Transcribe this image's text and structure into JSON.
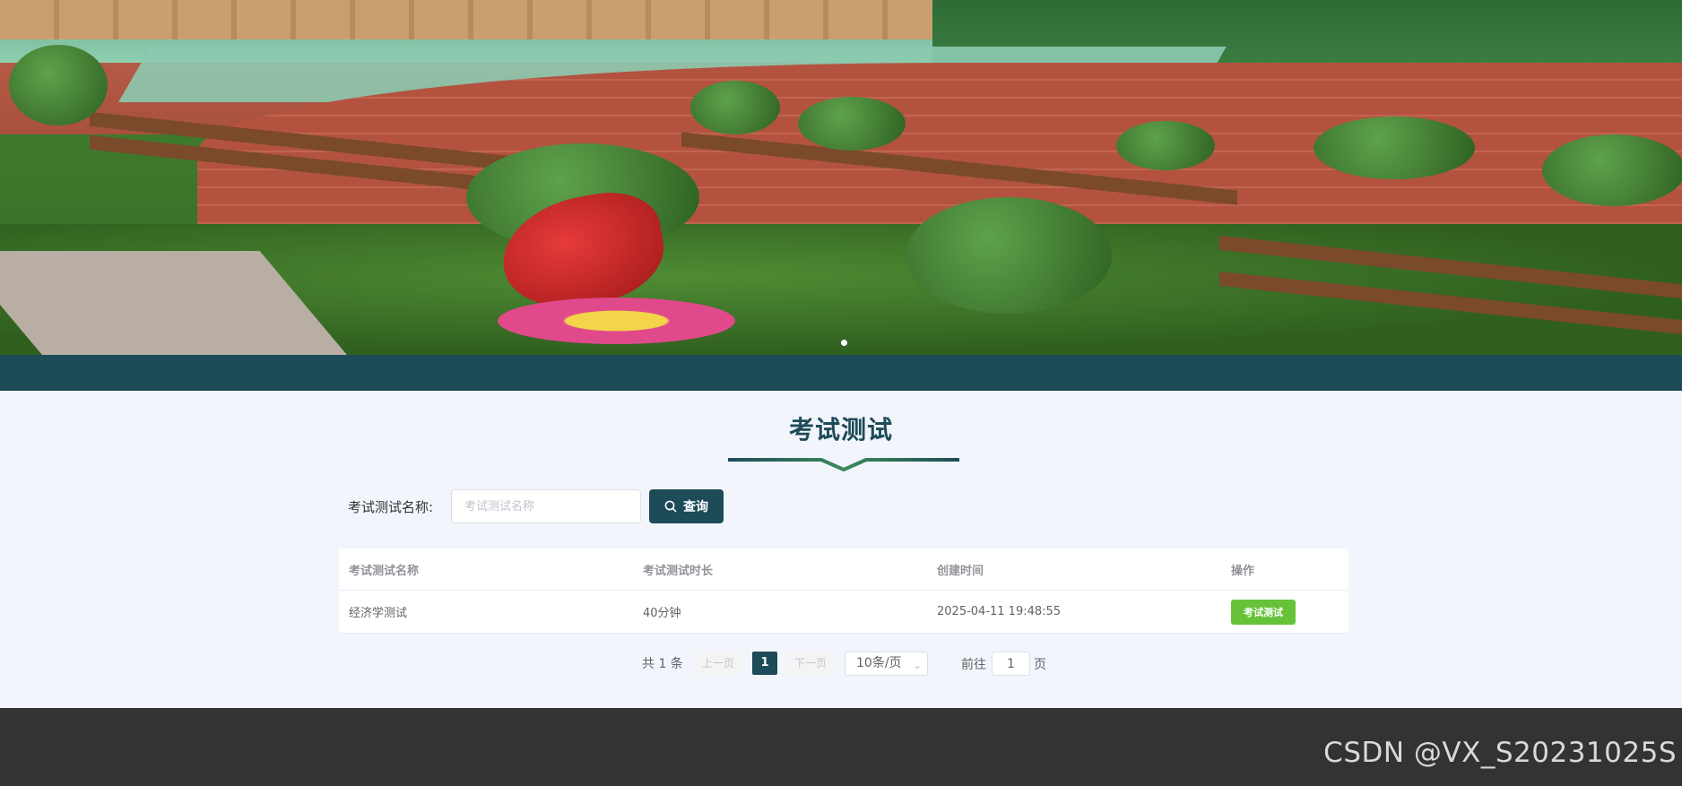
{
  "banner": {
    "indicator_count": 1,
    "active_indicator": 0
  },
  "page": {
    "title": "考试测试"
  },
  "search": {
    "label": "考试测试名称:",
    "placeholder": "考试测试名称",
    "value": "",
    "button_label": "查询",
    "button_icon": "search-icon"
  },
  "table": {
    "columns": [
      "考试测试名称",
      "考试测试时长",
      "创建时间",
      "操作"
    ],
    "rows": [
      {
        "name": "经济学测试",
        "duration": "40分钟",
        "created": "2025-04-11 19:48:55",
        "action": "考试测试"
      }
    ]
  },
  "pagination": {
    "total_text": "共 1 条",
    "prev_label": "上一页",
    "next_label": "下一页",
    "current_page": "1",
    "page_size": "10条/页",
    "goto_label": "前往",
    "goto_value": "1",
    "page_suffix": "页"
  },
  "footer": {
    "watermark": "CSDN @VX_S20231025S"
  },
  "colors": {
    "primary": "#1d4b58",
    "success": "#67c23a",
    "footer": "#333333",
    "accent_green": "#3c8a5a"
  }
}
